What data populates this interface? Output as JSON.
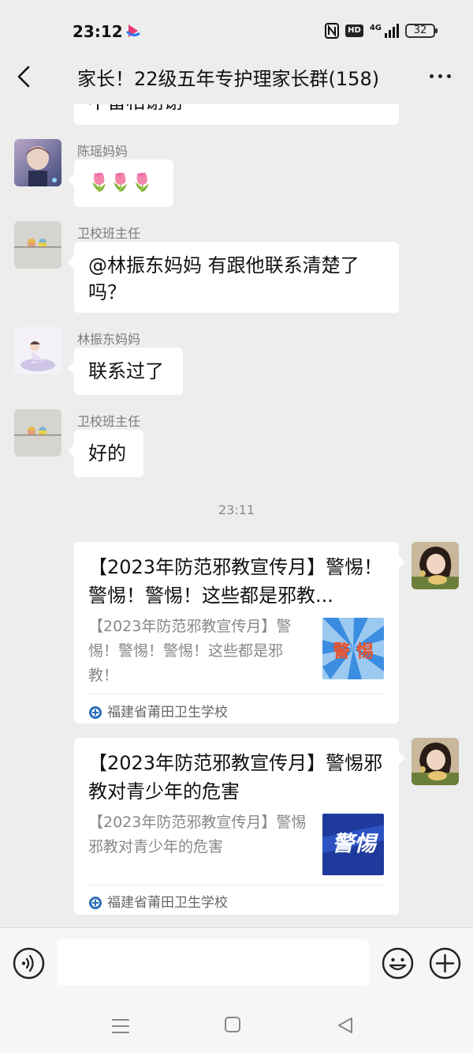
{
  "status_bar": {
    "time": "23:12",
    "network": "4G",
    "hd_label": "HD",
    "battery": "32"
  },
  "header": {
    "title": "家长！22级五年专护理家长群(158)"
  },
  "messages": {
    "partial_prev": "不留相谢谢",
    "m1": {
      "sender": "陈瑶妈妈",
      "text": "🌷🌷🌷"
    },
    "m2": {
      "sender": "卫校班主任",
      "text": "@林振东妈妈  有跟他联系清楚了吗？"
    },
    "m3": {
      "sender": "林振东妈妈",
      "text": "联系过了"
    },
    "m4": {
      "sender": "卫校班主任",
      "text": "好的"
    },
    "timestamp": "23:11",
    "card1": {
      "title": "【2023年防范邪教宣传月】警惕！警惕！警惕！这些都是邪教...",
      "desc": "【2023年防范邪教宣传月】警惕！警惕！警惕！这些都是邪教！",
      "thumb_text": "警 惕",
      "source": "福建省莆田卫生学校"
    },
    "card2": {
      "title": "【2023年防范邪教宣传月】警惕邪教对青少年的危害",
      "desc": "【2023年防范邪教宣传月】警惕邪教对青少年的危害",
      "thumb_text": "警惕",
      "source": "福建省莆田卫生学校"
    }
  },
  "input_bar": {
    "placeholder": ""
  },
  "colors": {
    "background": "#ededed",
    "bubble": "#ffffff",
    "thumb1_blue": "#3a8de0",
    "thumb1_text": "#e8502a",
    "thumb2_bg": "#1e3a9c"
  }
}
